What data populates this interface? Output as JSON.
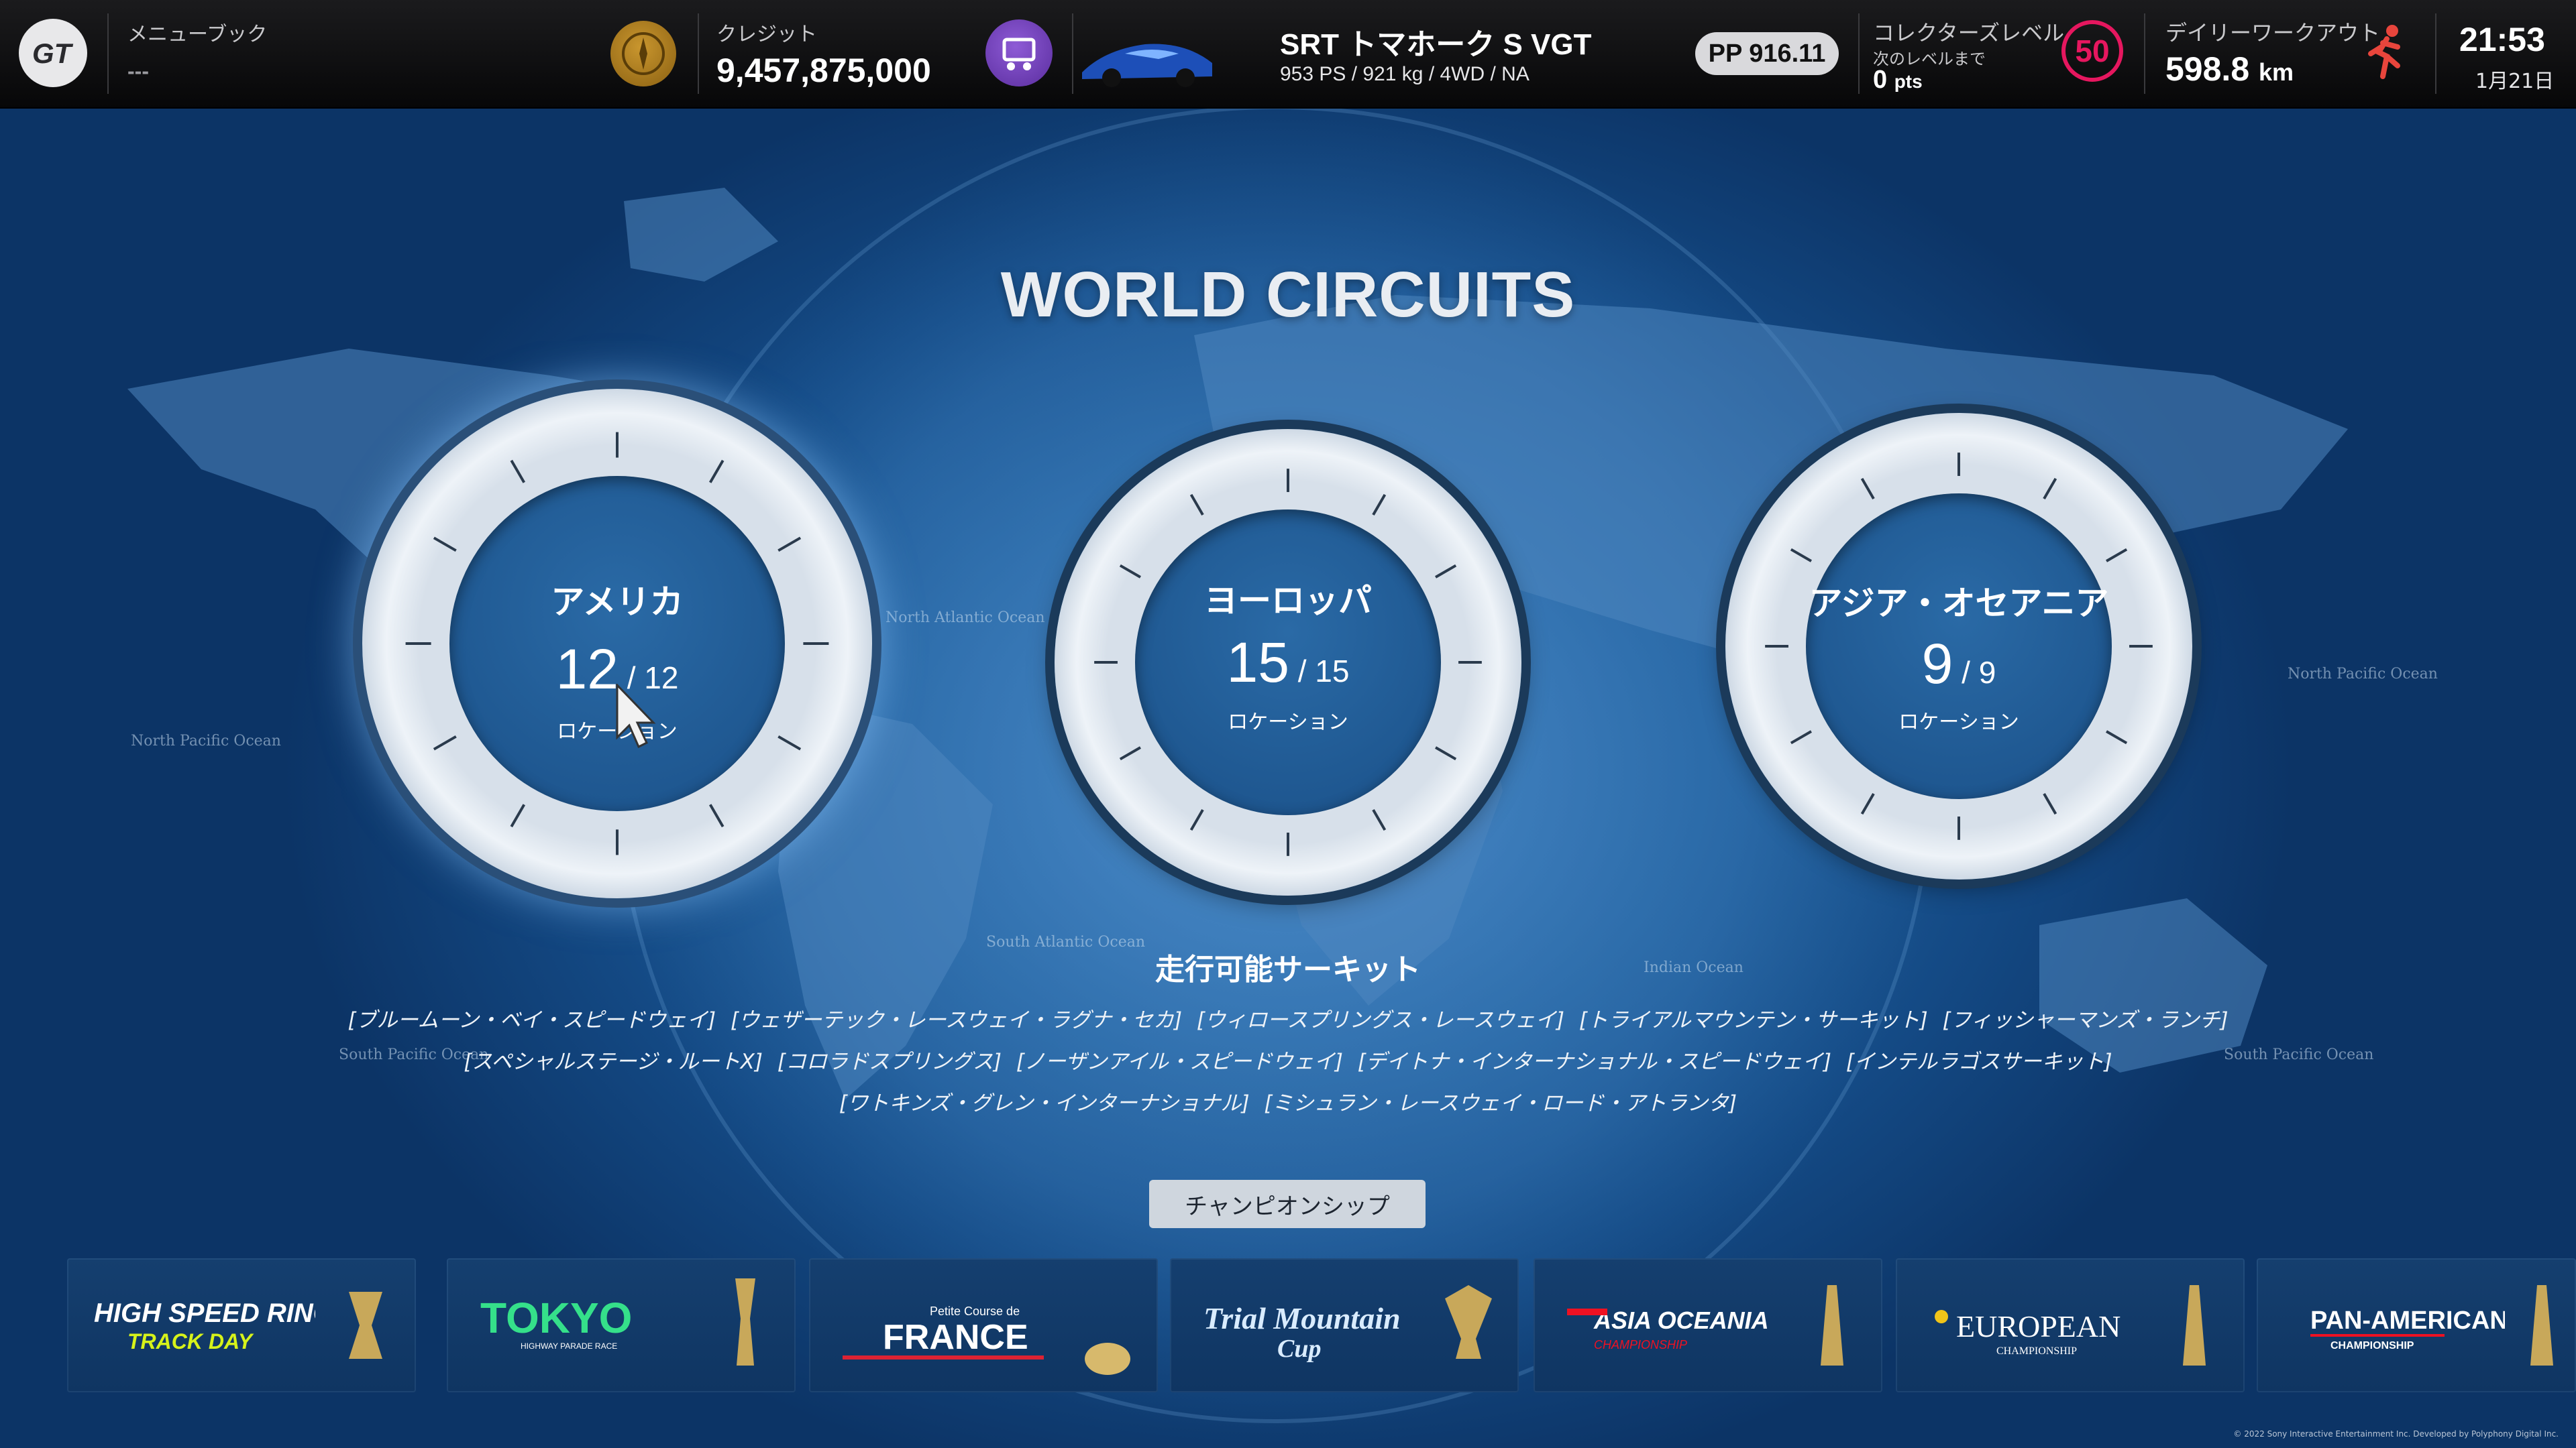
{
  "header": {
    "menu_book_label": "メニューブック",
    "menu_book_value": "---",
    "credit_label": "クレジット",
    "credit_value": "9,457,875,000",
    "car_name": "SRT トマホーク S VGT",
    "car_specs": "953 PS / 921 kg / 4WD / NA",
    "pp": "PP 916.11",
    "collector_label": "コレクターズレベル",
    "collector_next": "次のレベルまで",
    "collector_pts": "0",
    "collector_pts_unit": "pts",
    "level": "50",
    "workout_label": "デイリーワークアウト",
    "workout_value": "598.8",
    "workout_unit": "km",
    "time": "21:53",
    "date": "1月21日"
  },
  "title": "WORLD CIRCUITS",
  "regions": [
    {
      "name": "アメリカ",
      "count": "12",
      "total": "12",
      "label": "ロケーション"
    },
    {
      "name": "ヨーロッパ",
      "count": "15",
      "total": "15",
      "label": "ロケーション"
    },
    {
      "name": "アジア・オセアニア",
      "count": "9",
      "total": "9",
      "label": "ロケーション"
    }
  ],
  "circuits": {
    "heading": "走行可能サーキット",
    "line1": [
      "[ブルームーン・ベイ・スピードウェイ]",
      "[ウェザーテック・レースウェイ・ラグナ・セカ]",
      "[ウィロースプリングス・レースウェイ]",
      "[トライアルマウンテン・サーキット]",
      "[フィッシャーマンズ・ランチ]"
    ],
    "line2": [
      "[スペシャルステージ・ルートX]",
      "[コロラドスプリングス]",
      "[ノーザンアイル・スピードウェイ]",
      "[デイトナ・インターナショナル・スピードウェイ]",
      "[インテルラゴスサーキット]"
    ],
    "line3": [
      "[ワトキンズ・グレン・インターナショナル]",
      "[ミシュラン・レースウェイ・ロード・アトランタ]"
    ]
  },
  "championship_button": "チャンピオンシップ",
  "events": [
    {
      "logo_line1": "HIGH SPEED RING",
      "logo_line2": "TRACK DAY"
    },
    {
      "logo_line1": "TOKYO",
      "logo_line2": "HIGHWAY PARADE RACE"
    },
    {
      "logo_line1": "FRANCE",
      "logo_line2": "Petite Course de"
    },
    {
      "logo_line1": "Trial Mountain",
      "logo_line2": "Cup"
    },
    {
      "logo_line1": "ASIA OCEANIA",
      "logo_line2": "CHAMPIONSHIP"
    },
    {
      "logo_line1": "EUROPEAN",
      "logo_line2": "CHAMPIONSHIP"
    },
    {
      "logo_line1": "PAN-AMERICAN",
      "logo_line2": "CHAMPIONSHIP"
    }
  ],
  "map_labels": [
    "North Pacific Ocean",
    "North Atlantic Ocean",
    "South Atlantic Ocean",
    "Indian Ocean",
    "South Pacific Ocean",
    "North Pacific Ocean",
    "South Pacific Ocean"
  ],
  "copyright": "© 2022 Sony Interactive Entertainment Inc. Developed by Polyphony Digital Inc.",
  "colors": {
    "accent_level": "#e6175f",
    "background": "#23629f",
    "credit_icon": "#c9962e",
    "purple_icon": "#8e5bd6"
  },
  "icons": [
    "gt-logo-icon",
    "credit-coin-icon",
    "garage-icon",
    "car-thumbnail",
    "runner-icon",
    "cursor-icon",
    "trophy-icon"
  ]
}
